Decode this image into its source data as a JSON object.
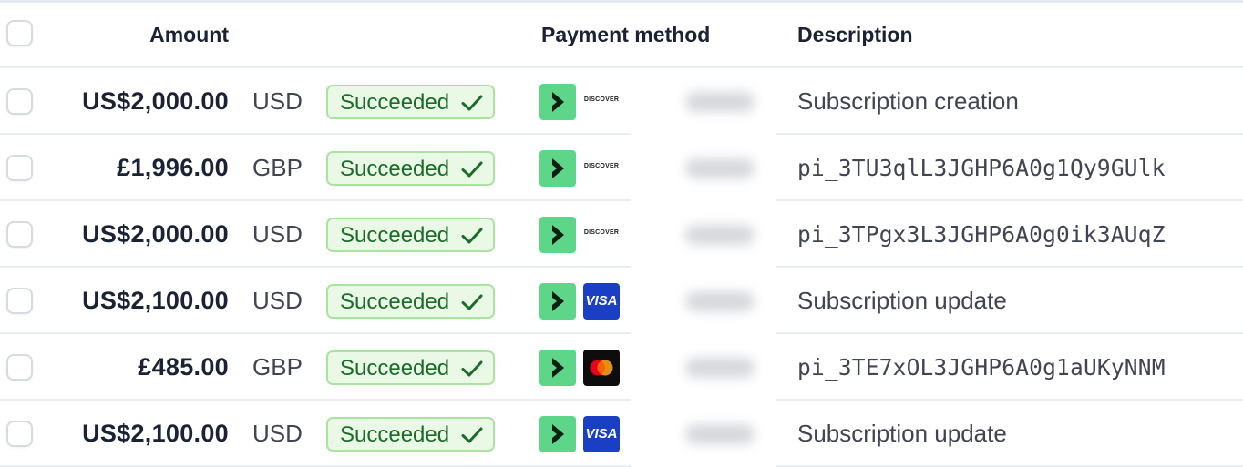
{
  "header": {
    "amount": "Amount",
    "payment_method": "Payment method",
    "description": "Description"
  },
  "rows": [
    {
      "amount": "US$2,000.00",
      "currency": "USD",
      "status": "Succeeded",
      "card": "discover",
      "card_label": "DISCOVER",
      "description": "Subscription creation",
      "mono": false
    },
    {
      "amount": "£1,996.00",
      "currency": "GBP",
      "status": "Succeeded",
      "card": "discover",
      "card_label": "DISCOVER",
      "description": "pi_3TU3qlL3JGHP6A0g1Qy9GUlk",
      "mono": true
    },
    {
      "amount": "US$2,000.00",
      "currency": "USD",
      "status": "Succeeded",
      "card": "discover",
      "card_label": "DISCOVER",
      "description": "pi_3TPgx3L3JGHP6A0g0ik3AUqZ",
      "mono": true
    },
    {
      "amount": "US$2,100.00",
      "currency": "USD",
      "status": "Succeeded",
      "card": "visa",
      "card_label": "VISA",
      "description": "Subscription update",
      "mono": false
    },
    {
      "amount": "£485.00",
      "currency": "GBP",
      "status": "Succeeded",
      "card": "mastercard",
      "card_label": "",
      "description": "pi_3TE7xOL3JGHP6A0g1aUKyNNM",
      "mono": true
    },
    {
      "amount": "US$2,100.00",
      "currency": "USD",
      "status": "Succeeded",
      "card": "visa",
      "card_label": "VISA",
      "description": "Subscription update",
      "mono": false
    }
  ],
  "icons": {
    "status": "checkmark-icon",
    "payment_provider": "chevron-right-icon"
  },
  "colors": {
    "success_text": "#1c6b2a",
    "success_bg": "#e9f9e6",
    "success_border": "#a8e3a0",
    "provider_green": "#5ed68a",
    "visa_blue": "#1a3fc4"
  }
}
